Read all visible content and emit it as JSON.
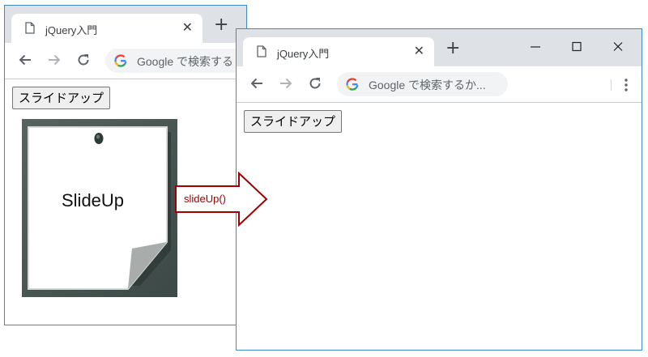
{
  "colors": {
    "window_border": "#3c8ac8",
    "chrome_frame": "#dee1e6",
    "arrow_stroke": "#a00000",
    "arrow_text": "#a00000",
    "note_frame": "#44534f"
  },
  "window_before": {
    "tab_title": "jQuery入門",
    "omnibox_text": "Google で検索する",
    "slide_button_label": "スライドアップ",
    "note_text": "SlideUp"
  },
  "window_after": {
    "tab_title": "jQuery入門",
    "omnibox_text": "Google で検索するか...",
    "slide_button_label": "スライドアップ"
  },
  "arrow": {
    "label": "slideUp()"
  },
  "icons": [
    "page-icon",
    "close-icon",
    "new-tab-icon",
    "minimize-icon",
    "maximize-icon",
    "window-close-icon",
    "back-arrow-icon",
    "forward-arrow-icon",
    "reload-icon",
    "google-g-icon",
    "kebab-menu-icon"
  ]
}
